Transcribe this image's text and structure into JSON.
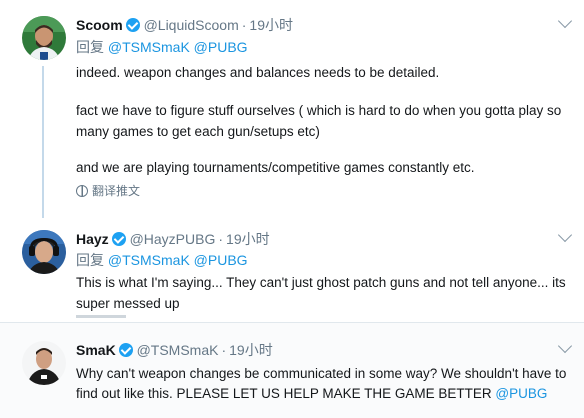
{
  "tweets": [
    {
      "name": "Scoom",
      "handle": "@LiquidScoom",
      "time": "19小时",
      "reply_prefix": "回复",
      "reply_mentions": "@TSMSmaK @PUBG",
      "lines": [
        "indeed. weapon changes and balances needs to be detailed.",
        "fact we have to figure stuff ourselves ( which is hard to do when you gotta play so",
        "many games to get each gun/setups etc)",
        "and we are playing tournaments/competitive games constantly etc."
      ],
      "translate": "翻译推文"
    },
    {
      "name": "Hayz",
      "handle": "@HayzPUBG",
      "time": "19小时",
      "reply_prefix": "回复",
      "reply_mentions": "@TSMSmaK @PUBG",
      "lines": [
        "This is what I'm saying... They can't just ghost patch guns and not tell anyone... its",
        "super messed up"
      ]
    },
    {
      "name": "SmaK",
      "handle": "@TSMSmaK",
      "time": "19小时",
      "lines": [
        "Why can't weapon changes be communicated in some way? We shouldn't have to",
        "find out like this. PLEASE LET US HELP MAKE THE GAME BETTER"
      ],
      "trailing_mention": "@PUBG"
    }
  ],
  "colors": {
    "link": "#1b95e0",
    "verified": "#1da1f2",
    "muted": "#657786",
    "thread_line": "#c4d9ea"
  }
}
